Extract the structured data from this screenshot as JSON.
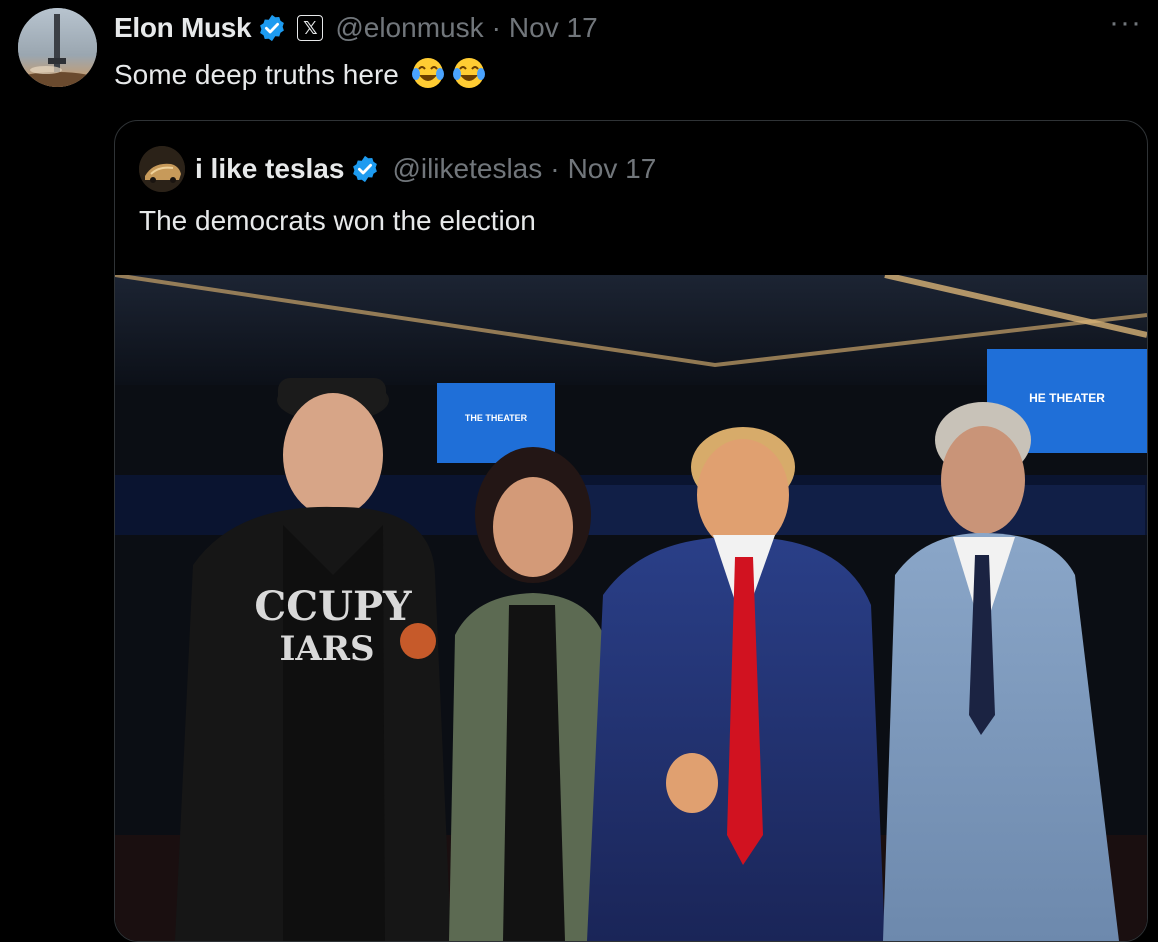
{
  "tweet": {
    "author_name": "Elon Musk",
    "affiliation_glyph": "𝕏",
    "handle": "@elonmusk",
    "separator": "·",
    "date": "Nov 17",
    "text": "Some deep truths here",
    "emojis": [
      "face-with-tears-of-joy",
      "face-with-tears-of-joy"
    ],
    "more_label": "···"
  },
  "quoted": {
    "author_name": "i like teslas",
    "handle": "@iliketeslas",
    "separator": "·",
    "date": "Nov 17",
    "text": "The democrats won the election",
    "photo": {
      "screen_left": "THE THEATER",
      "screen_right": "HE THEATER",
      "shirt_line1": "CCUPY",
      "shirt_line2": "IARS"
    }
  },
  "icons": {
    "verified": "verified-badge-icon",
    "affiliation": "x-logo-icon",
    "more": "more-options-icon",
    "emoji": "face-with-tears-of-joy-emoji"
  },
  "colors": {
    "background": "#000000",
    "text_primary": "#e7e9ea",
    "text_secondary": "#71767b",
    "verified_blue": "#1d9bf0",
    "border": "#2f3336"
  }
}
